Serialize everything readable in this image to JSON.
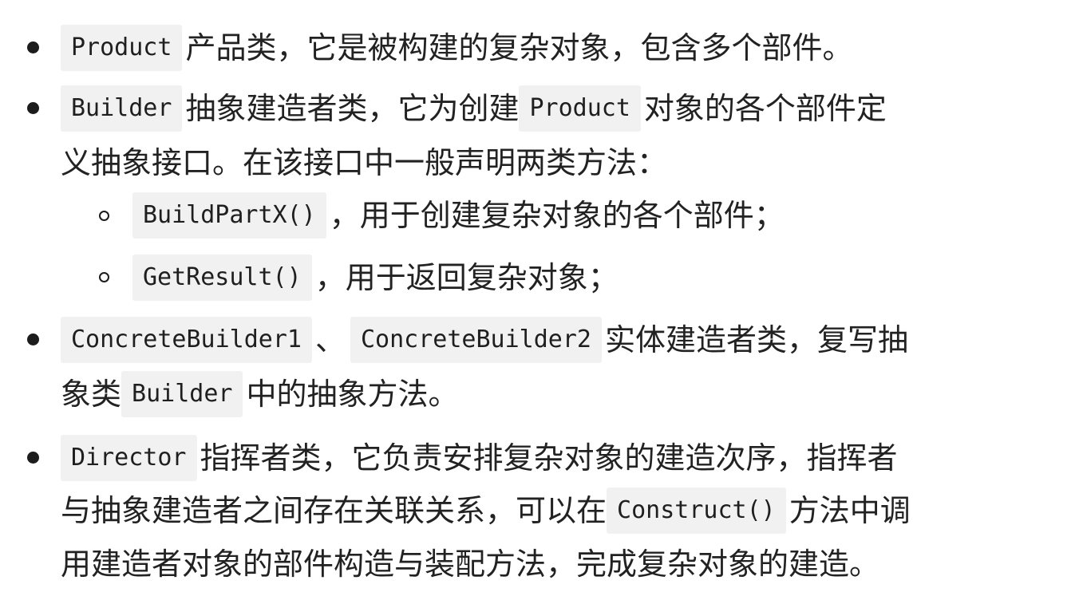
{
  "items": [
    {
      "code": "Product",
      "text": "产品类，它是被构建的复杂对象，包含多个部件。"
    },
    {
      "code": "Builder",
      "text_a": "抽象建造者类，它为创建",
      "code_b": "Product",
      "text_b": "对象的各个部件定",
      "line2": "义抽象接口。在该接口中一般声明两类方法：",
      "sub": [
        {
          "code": "BuildPartX()",
          "text": "，用于创建复杂对象的各个部件；"
        },
        {
          "code": "GetResult()",
          "text": "，用于返回复杂对象；"
        }
      ]
    },
    {
      "code": "ConcreteBuilder1",
      "sep": "、",
      "code_b": "ConcreteBuilder2",
      "text_b": "实体建造者类，复写抽",
      "line2_a": "象类",
      "line2_code": "Builder",
      "line2_b": "中的抽象方法。"
    },
    {
      "code": "Director",
      "text": "指挥者类，它负责安排复杂对象的建造次序，指挥者",
      "line2_a": "与抽象建造者之间存在关联关系，可以在",
      "line2_code": "Construct()",
      "line2_b": "方法中调",
      "line3": "用建造者对象的部件构造与装配方法，完成复杂对象的建造。"
    }
  ]
}
